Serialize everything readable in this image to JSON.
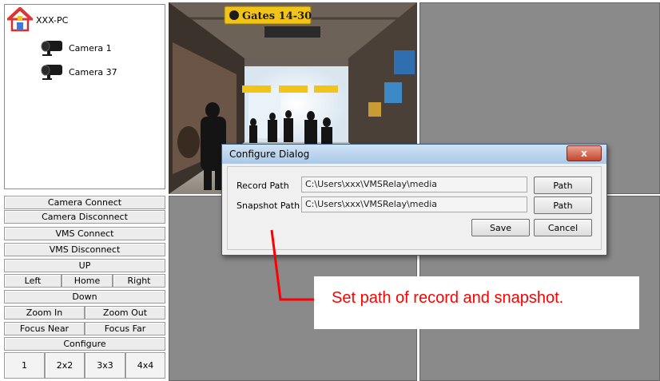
{
  "tree": {
    "root_label": "XXX-PC",
    "cameras": [
      "Camera 1",
      "Camera 37"
    ]
  },
  "controls": {
    "camera_connect": "Camera Connect",
    "camera_disconnect": "Camera Disconnect",
    "vms_connect": "VMS Connect",
    "vms_disconnect": "VMS Disconnect",
    "up": "UP",
    "left": "Left",
    "home": "Home",
    "right": "Right",
    "down": "Down",
    "zoom_in": "Zoom In",
    "zoom_out": "Zoom Out",
    "focus_near": "Focus Near",
    "focus_far": "Focus Far",
    "configure": "Configure",
    "layouts": [
      "1",
      "2x2",
      "3x3",
      "4x4"
    ]
  },
  "video": {
    "sign_text": "Gates 14-30"
  },
  "dialog": {
    "title": "Configure Dialog",
    "close_symbol": "x",
    "record_label": "Record Path",
    "record_value": "C:\\Users\\xxx\\VMSRelay\\media",
    "snapshot_label": "Snapshot Path",
    "snapshot_value": "C:\\Users\\xxx\\VMSRelay\\media",
    "path_button": "Path",
    "save_button": "Save",
    "cancel_button": "Cancel"
  },
  "annotation": {
    "text": "Set path of record and snapshot."
  },
  "colors": {
    "annotation_red": "#ff0000",
    "grid_gray": "#8a8a8a",
    "sign_yellow": "#f2c417"
  }
}
